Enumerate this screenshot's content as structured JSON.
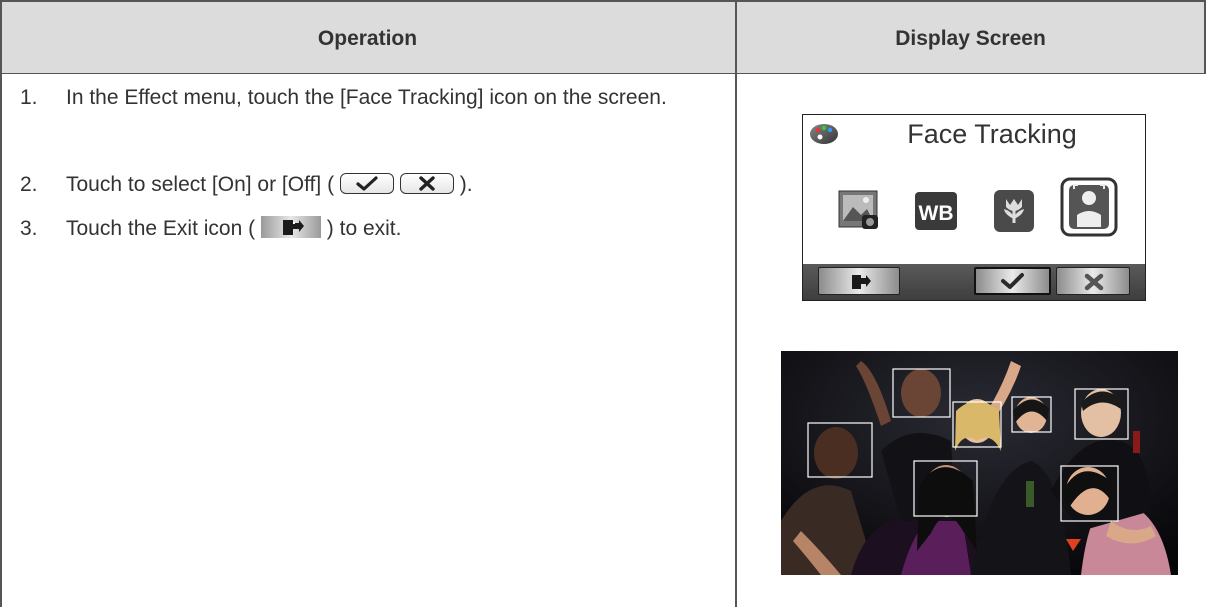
{
  "table": {
    "header_operation": "Operation",
    "header_display": "Display Screen"
  },
  "steps": [
    {
      "number": "1.",
      "text": "In the Effect menu, touch the [Face Tracking] icon on the screen."
    },
    {
      "number": "2.",
      "text_before": "Touch to select [On] or [Off] (",
      "text_after": ")."
    },
    {
      "number": "3.",
      "text_before": "Touch the Exit icon (",
      "text_after": ") to exit."
    }
  ],
  "camera_screen": {
    "title": "Face Tracking",
    "icons": [
      "photo-icon",
      "wb-icon",
      "macro-tulip-icon",
      "face-tracking-icon"
    ],
    "wb_label": "WB",
    "bottom_bar": [
      "exit-icon",
      "check-icon",
      "close-icon"
    ]
  },
  "photo": {
    "subject": "group-of-people-with-face-tracking-boxes",
    "face_boxes": 8
  }
}
